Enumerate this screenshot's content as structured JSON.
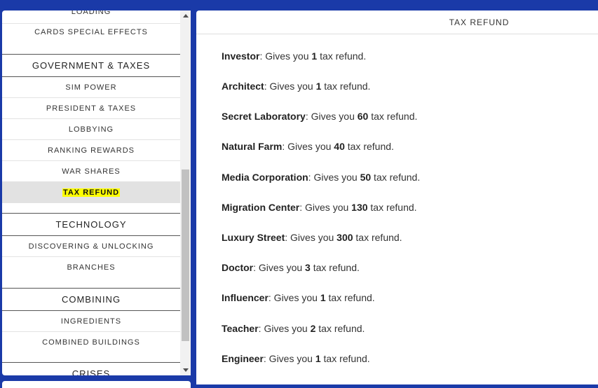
{
  "sidebar": {
    "items": [
      {
        "label": "LOADING",
        "kind": "sub"
      },
      {
        "label": "CARDS SPECIAL EFFECTS",
        "kind": "sub"
      },
      {
        "label": "GOVERNMENT & TAXES",
        "kind": "section"
      },
      {
        "label": "SIM POWER",
        "kind": "sub"
      },
      {
        "label": "PRESIDENT & TAXES",
        "kind": "sub"
      },
      {
        "label": "LOBBYING",
        "kind": "sub"
      },
      {
        "label": "RANKING REWARDS",
        "kind": "sub"
      },
      {
        "label": "WAR SHARES",
        "kind": "sub"
      },
      {
        "label": "TAX REFUND",
        "kind": "sub",
        "selected": true
      },
      {
        "label": "TECHNOLOGY",
        "kind": "section"
      },
      {
        "label": "DISCOVERING & UNLOCKING",
        "kind": "sub"
      },
      {
        "label": "BRANCHES",
        "kind": "sub"
      },
      {
        "label": "COMBINING",
        "kind": "section"
      },
      {
        "label": "INGREDIENTS",
        "kind": "sub"
      },
      {
        "label": "COMBINED BUILDINGS",
        "kind": "sub"
      },
      {
        "label": "CRISES",
        "kind": "section"
      }
    ],
    "highlight_color": "#ffff00",
    "selected_bg": "#e2e2e2"
  },
  "content": {
    "title": "TAX REFUND",
    "prefix": ": Gives you ",
    "suffix": " tax refund.",
    "entries": [
      {
        "name": "Investor",
        "amount": "1"
      },
      {
        "name": "Architect",
        "amount": "1"
      },
      {
        "name": "Secret Laboratory",
        "amount": "60"
      },
      {
        "name": "Natural Farm",
        "amount": "40"
      },
      {
        "name": "Media Corporation",
        "amount": "50"
      },
      {
        "name": "Migration Center",
        "amount": "130"
      },
      {
        "name": "Luxury Street",
        "amount": "300"
      },
      {
        "name": "Doctor",
        "amount": "3"
      },
      {
        "name": "Influencer",
        "amount": "1"
      },
      {
        "name": "Teacher",
        "amount": "2"
      },
      {
        "name": "Engineer",
        "amount": "1"
      }
    ]
  },
  "colors": {
    "background": "#1a3aa8",
    "panel": "#ffffff"
  },
  "icons": {
    "scroll_up": "triangle-up-icon",
    "scroll_down": "triangle-down-icon"
  }
}
